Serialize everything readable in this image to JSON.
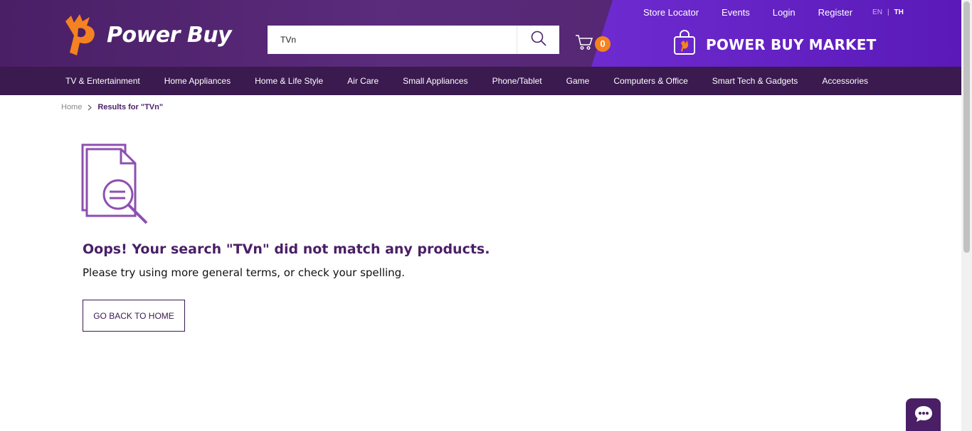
{
  "brand": {
    "name": "Power Buy"
  },
  "search": {
    "value": "TVn",
    "placeholder": ""
  },
  "cart": {
    "count": "0"
  },
  "top_links": [
    "Store Locator",
    "Events",
    "Login",
    "Register"
  ],
  "language": {
    "en": "EN",
    "separator": "|",
    "th": "TH",
    "active": "TH"
  },
  "market": {
    "label": "POWER BUY MARKET"
  },
  "nav": [
    "TV & Entertainment",
    "Home Appliances",
    "Home & Life Style",
    "Air Care",
    "Small Appliances",
    "Phone/Tablet",
    "Game",
    "Computers & Office",
    "Smart Tech & Gadgets",
    "Accessories"
  ],
  "breadcrumb": {
    "home": "Home",
    "current": "Results for \"TVn\""
  },
  "empty": {
    "title": "Oops! Your search \"TVn\" did not match any products.",
    "hint": "Please try using more general terms, or check your spelling.",
    "button": "GO BACK TO HOME"
  },
  "colors": {
    "primary": "#4a1f66",
    "nav": "#3a1a4f",
    "accent": "#f58220",
    "market": "#6e2bd0"
  },
  "icons": [
    "power-buy-logo-icon",
    "search-icon",
    "cart-icon",
    "shopping-bag-icon",
    "chevron-right-icon",
    "document-search-icon",
    "chat-icon"
  ]
}
